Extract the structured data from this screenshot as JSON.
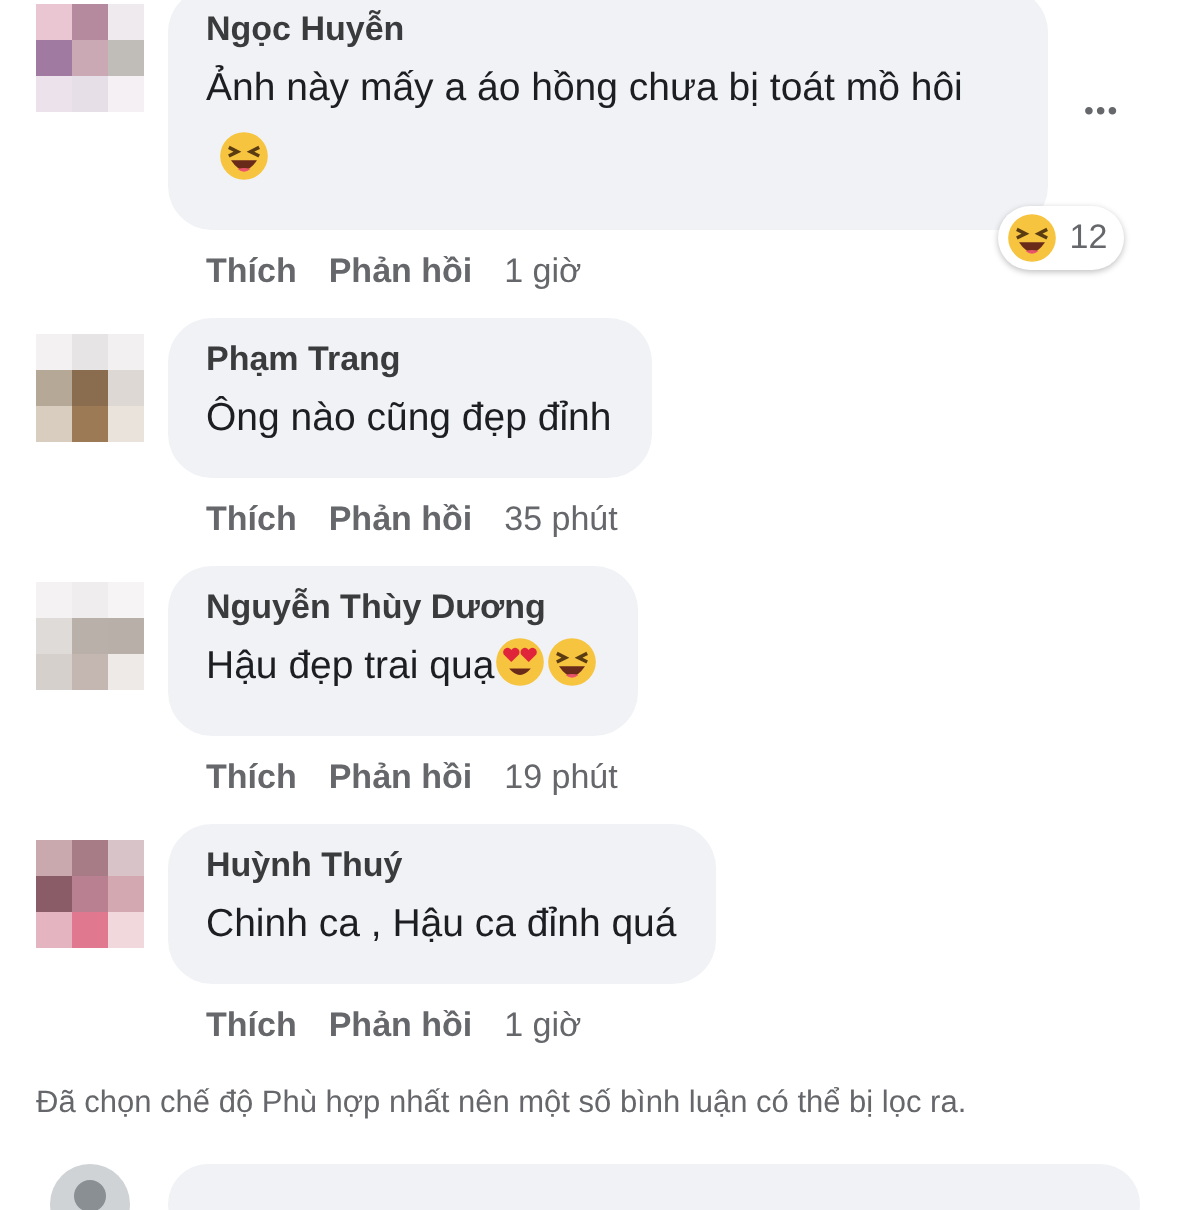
{
  "comments": [
    {
      "author": "Ngọc Huyễn",
      "text": "Ảnh này mấy a áo hồng chưa bị toát mồ hôi",
      "emojis": [
        {
          "kind": "laughing"
        }
      ],
      "reaction": {
        "kind": "laughing",
        "count": "12"
      },
      "more": "•••",
      "actions": [
        "Thích",
        "Phản hồi"
      ],
      "time": "1 giờ"
    },
    {
      "author": "Phạm Trang",
      "text": "Ông nào cũng đẹp đỉnh",
      "actions": [
        "Thích",
        "Phản hồi"
      ],
      "time": "35 phút"
    },
    {
      "author": "Nguyễn Thùy Dương",
      "text": "Hậu đẹp trai quạ",
      "emojis": [
        {
          "kind": "heart-eyes"
        },
        {
          "kind": "laughing"
        }
      ],
      "actions": [
        "Thích",
        "Phản hồi"
      ],
      "time": "19 phút"
    },
    {
      "author": "Huỳnh Thuý",
      "text": "Chinh ca , Hậu ca đỉnh quá",
      "actions": [
        "Thích",
        "Phản hồi"
      ],
      "time": "1 giờ"
    }
  ],
  "notice": "Đã chọn chế độ Phù hợp nhất nên một số bình luận có thể bị lọc ra."
}
